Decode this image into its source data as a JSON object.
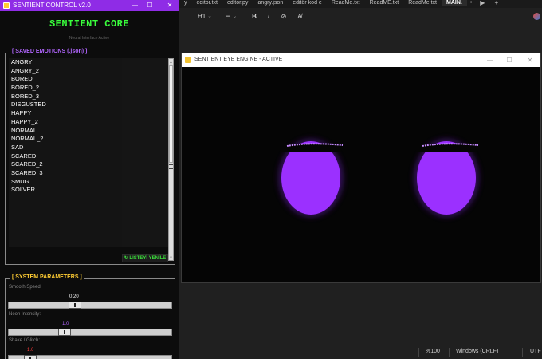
{
  "editor": {
    "tabs": [
      "y",
      "editor.txt",
      "editor.py",
      "angry.json",
      "editör kod e",
      "ReadMe.txt",
      "ReadME.txt",
      "ReadMe.txt",
      "MAIN."
    ],
    "active_tab": "MAIN.",
    "tab_dot": "•",
    "play_icon": "▶",
    "plus_icon": "+",
    "toolbar": {
      "heading": "H1",
      "list_icon": "☰",
      "bold": "B",
      "italic": "I",
      "link_icon": "⊘",
      "clear_icon": "A̸",
      "chevron": "⌄"
    },
    "status": {
      "zoom": "%100",
      "line_ending": "Windows (CRLF)",
      "encoding": "UTF"
    }
  },
  "control": {
    "window_title": "SENTIENT CONTROL v2.0",
    "minimize": "—",
    "maximize": "☐",
    "close": "✕",
    "app_title": "SENTIENT CORE",
    "app_subtitle": "Neural Interface Active",
    "emotions": {
      "legend": "[ SAVED EMOTIONS (.json) ]",
      "items": [
        "ANGRY",
        "ANGRY_2",
        "BORED",
        "BORED_2",
        "BORED_3",
        "DISGUSTED",
        "HAPPY",
        "HAPPY_2",
        "NORMAL",
        "NORMAL_2",
        "SAD",
        "SCARED",
        "SCARED_2",
        "SCARED_3",
        "SMUG",
        "SOLVER"
      ],
      "refresh_label": "↻ LISTEYİ YENİLE",
      "scroll_up": "▲",
      "scroll_down": "▼"
    },
    "params": {
      "legend": "[ SYSTEM PARAMETERS ]",
      "smooth_label": "Smooth Speed:",
      "smooth_value": "0.20",
      "smooth_fraction": 0.4,
      "neon_label": "Neon Intensity:",
      "neon_value": "1.0",
      "neon_fraction": 0.33,
      "shake_label": "Shake / Glitch:",
      "shake_value": "1.0",
      "shake_fraction": 0.1
    },
    "colors": {
      "title_green": "#39ff3c",
      "legend_purple": "#b266ff",
      "titlebar_purple": "#8f2ce6",
      "neon_value": "#b266ff",
      "shake_value": "#ff3b3b",
      "smooth_value": "#ffffff"
    }
  },
  "eye_engine": {
    "window_title": "SENTIENT EYE ENGINE - ACTIVE",
    "minimize": "—",
    "maximize": "☐",
    "close": "✕",
    "eye_color": "#9b30ff"
  }
}
